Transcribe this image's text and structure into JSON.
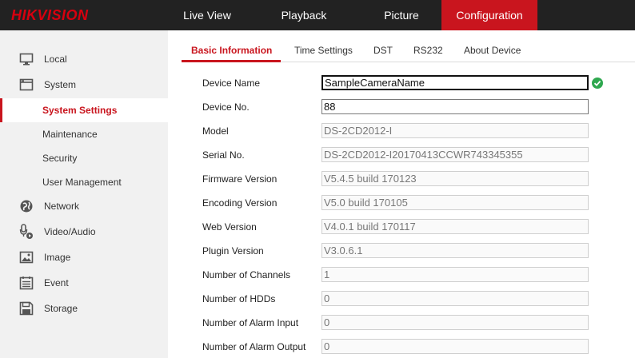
{
  "brand": {
    "logo_text": "HIKVISION",
    "accent_color": "#c9151e"
  },
  "topnav": {
    "live_view": "Live View",
    "playback": "Playback",
    "picture": "Picture",
    "configuration": "Configuration"
  },
  "sidebar": {
    "local": "Local",
    "system": "System",
    "system_settings": "System Settings",
    "maintenance": "Maintenance",
    "security": "Security",
    "user_management": "User Management",
    "network": "Network",
    "video_audio": "Video/Audio",
    "image": "Image",
    "event": "Event",
    "storage": "Storage"
  },
  "tabs": {
    "basic_information": "Basic Information",
    "time_settings": "Time Settings",
    "dst": "DST",
    "rs232": "RS232",
    "about_device": "About Device"
  },
  "form": {
    "device_name": {
      "label": "Device Name",
      "value": "SampleCameraName"
    },
    "device_no": {
      "label": "Device No.",
      "value": "88"
    },
    "model": {
      "label": "Model",
      "value": "DS-2CD2012-I"
    },
    "serial_no": {
      "label": "Serial No.",
      "value": "DS-2CD2012-I20170413CCWR743345355"
    },
    "firmware_version": {
      "label": "Firmware Version",
      "value": "V5.4.5 build 170123"
    },
    "encoding_version": {
      "label": "Encoding Version",
      "value": "V5.0 build 170105"
    },
    "web_version": {
      "label": "Web Version",
      "value": "V4.0.1 build 170117"
    },
    "plugin_version": {
      "label": "Plugin Version",
      "value": "V3.0.6.1"
    },
    "channels": {
      "label": "Number of Channels",
      "value": "1"
    },
    "hdds": {
      "label": "Number of HDDs",
      "value": "0"
    },
    "alarm_input": {
      "label": "Number of Alarm Input",
      "value": "0"
    },
    "alarm_output": {
      "label": "Number of Alarm Output",
      "value": "0"
    }
  }
}
